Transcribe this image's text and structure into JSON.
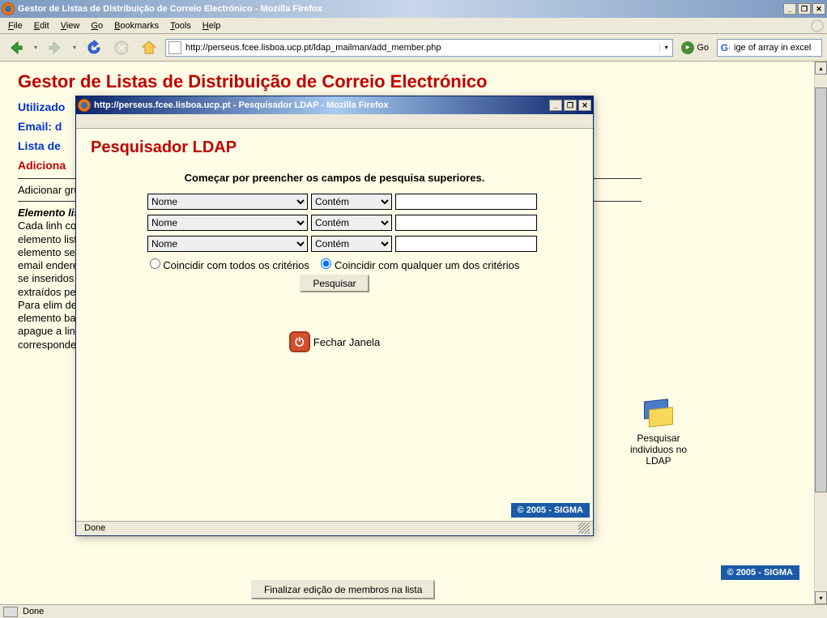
{
  "main_window": {
    "title": "Gestor de Listas de Distribuição de Correio Electrónico - Mozilla Firefox",
    "menus": {
      "file": "File",
      "edit": "Edit",
      "view": "View",
      "go": "Go",
      "bookmarks": "Bookmarks",
      "tools": "Tools",
      "help": "Help"
    },
    "url": "http://perseus.fcee.lisboa.ucp.pt/ldap_mailman/add_member.php",
    "go_label": "Go",
    "search_value": "ige of array in excel",
    "status": "Done"
  },
  "page": {
    "heading": "Gestor de Listas de Distribuição de Correio Electrónico",
    "user_label": "Utilizado",
    "email_label": "Email: d",
    "list_label": "Lista de",
    "add_label": "Adiciona",
    "add_groups": "Adicionar grupos:",
    "body_heading": "Elemento lista:",
    "body_text": "Cada linh correspon elemento lista. Cad elemento ser um gr um email endereço podem se inseridos manualm extraídos pesquisa Para elim determinado elemento basta que apague a linha correspondente.",
    "ldap_link": "Pesquisar individuos no LDAP",
    "finalize_btn": "Finalizar edição de membros na lista",
    "sigma": "© 2005 - SIGMA"
  },
  "popup": {
    "title": "http://perseus.fcee.lisboa.ucp.pt - Pesquisador LDAP - Mozilla Firefox",
    "heading": "Pesquisador LDAP",
    "instruction": "Começar por preencher os campos de pesquisa superiores.",
    "field_options": [
      "Nome"
    ],
    "operator_options": [
      "Contém"
    ],
    "rows": [
      {
        "field": "Nome",
        "op": "Contém",
        "val": ""
      },
      {
        "field": "Nome",
        "op": "Contém",
        "val": ""
      },
      {
        "field": "Nome",
        "op": "Contém",
        "val": ""
      }
    ],
    "match_all": "Coincidir com todos os critérios",
    "match_any": "Coincidir com qualquer um dos critérios",
    "search_btn": "Pesquisar",
    "close_label": "Fechar Janela",
    "sigma": "© 2005 - SIGMA",
    "status": "Done"
  }
}
